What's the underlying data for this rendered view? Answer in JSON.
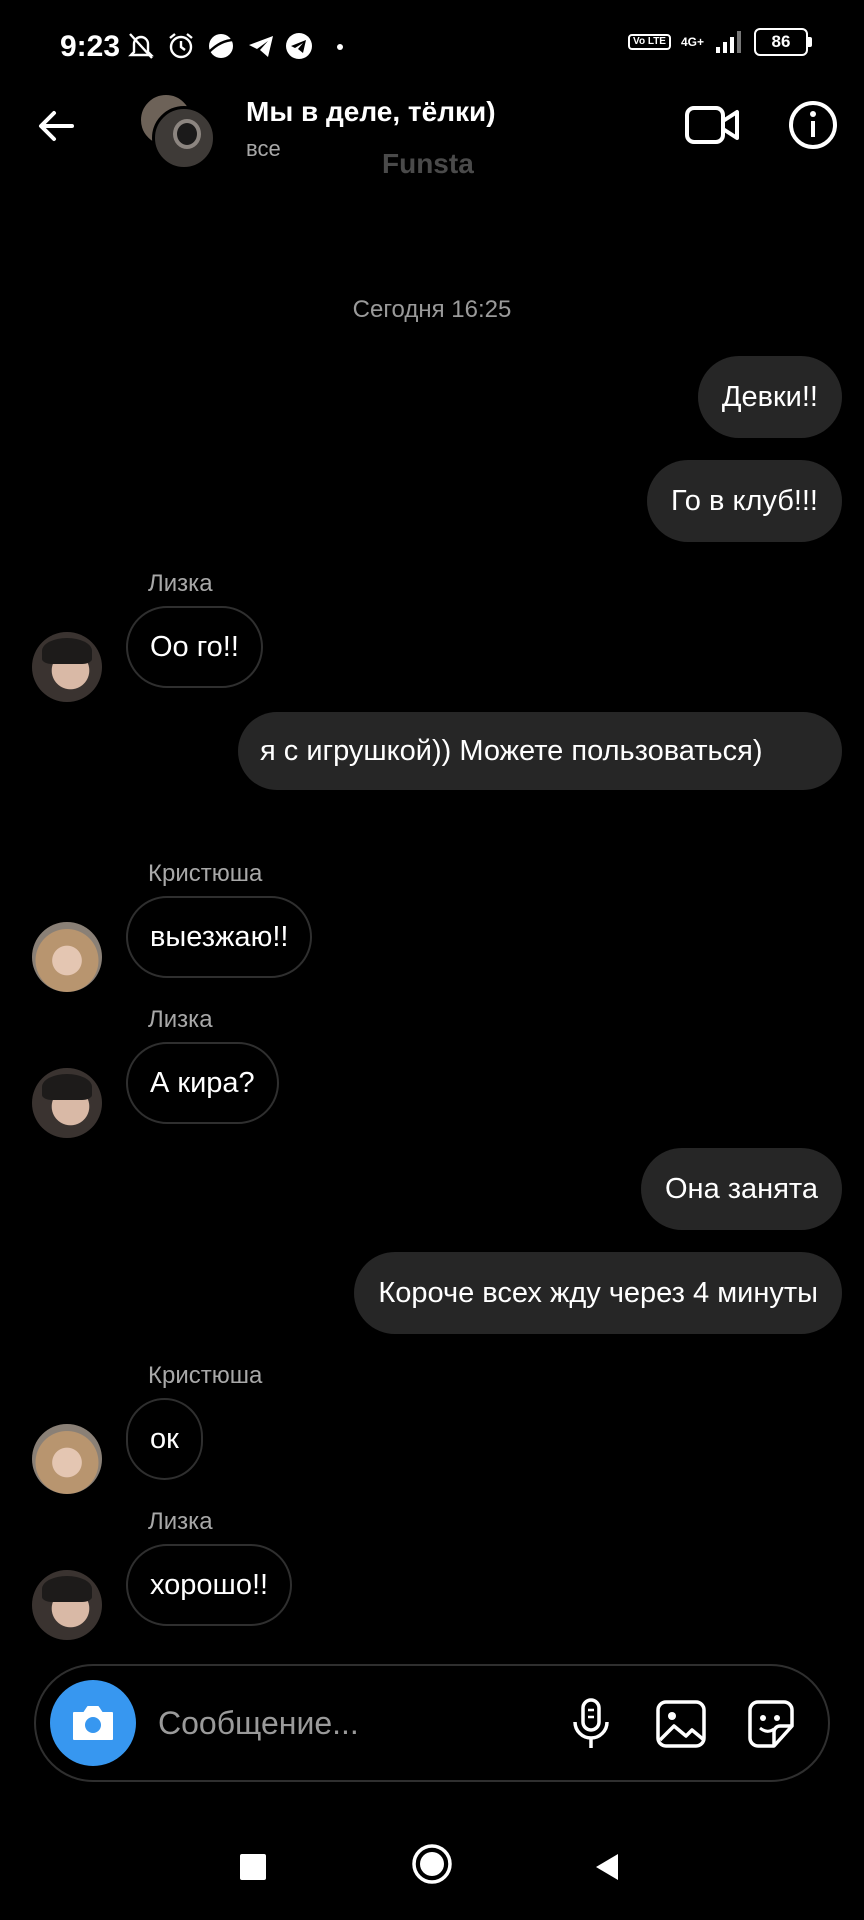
{
  "status_bar": {
    "time": "9:23",
    "volte": "Vo LTE",
    "network": "4G+",
    "battery": "86"
  },
  "header": {
    "title": "Мы в деле, тёлки)",
    "subtitle": "все",
    "watermark": "Funsta"
  },
  "timestamp": "Сегодня 16:25",
  "messages": [
    {
      "side": "out",
      "text": "Девки!!"
    },
    {
      "side": "out",
      "text": "Го в клуб!!!"
    },
    {
      "side": "in",
      "sender": "Лизка",
      "text": "Оо го!!"
    },
    {
      "side": "out",
      "text": "я с игрушкой)) Можете пользоваться)"
    },
    {
      "side": "in",
      "sender": "Кристюша",
      "text": "выезжаю!!"
    },
    {
      "side": "in",
      "sender": "Лизка",
      "text": "А кира?"
    },
    {
      "side": "out",
      "text": "Она занята"
    },
    {
      "side": "out",
      "text": "Короче всех жду через 4 минуты"
    },
    {
      "side": "in",
      "sender": "Кристюша",
      "text": "ок"
    },
    {
      "side": "in",
      "sender": "Лизка",
      "text": "хорошо!!"
    }
  ],
  "composer": {
    "placeholder": "Сообщение..."
  },
  "icons": {
    "back": "arrow-left-icon",
    "video": "video-camera-icon",
    "info": "info-icon",
    "camera": "camera-icon",
    "mic": "microphone-icon",
    "gallery": "image-icon",
    "sticker": "sticker-icon"
  },
  "colors": {
    "background": "#000000",
    "outgoing_bubble": "#262626",
    "accent": "#3797f0"
  }
}
